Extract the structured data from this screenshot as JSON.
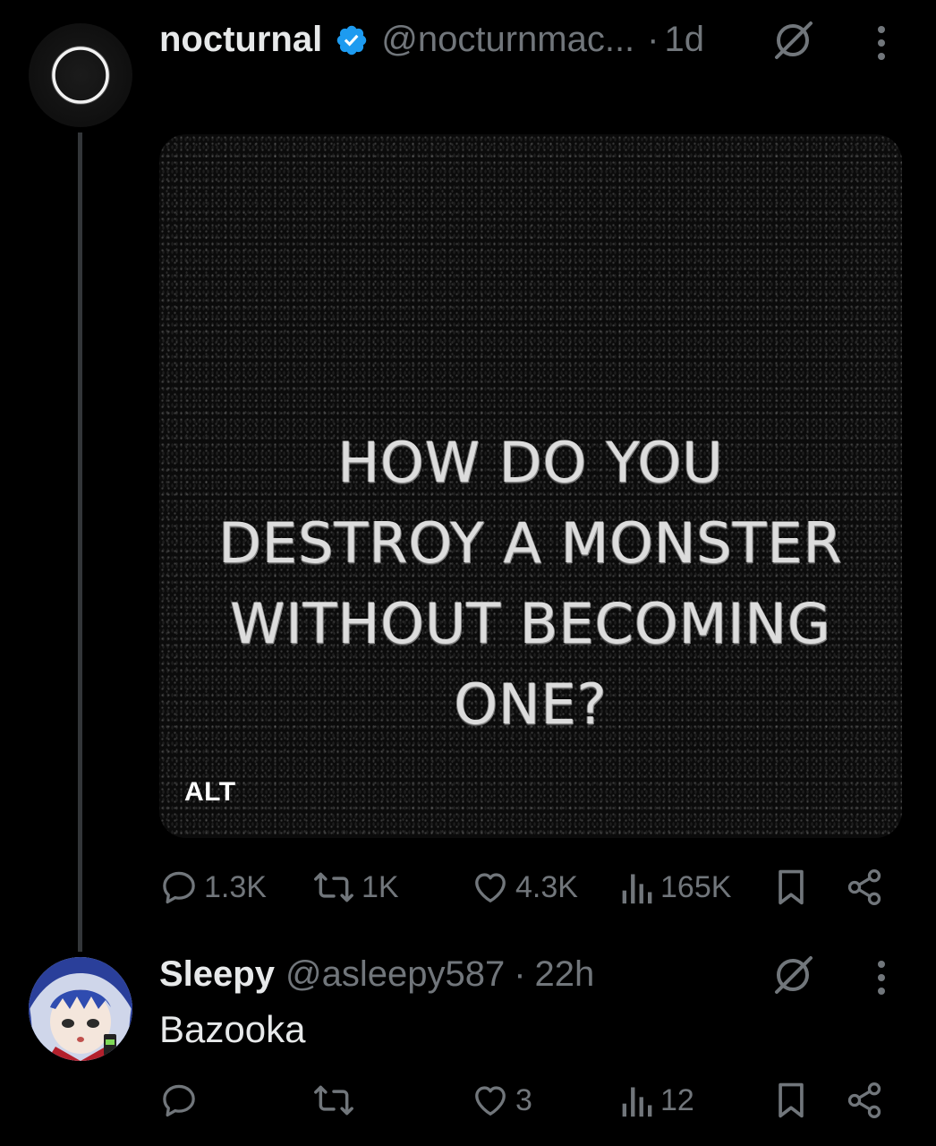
{
  "post": {
    "display_name": "nocturnal",
    "handle": "@nocturnmac...",
    "separator": "·",
    "time": "1d",
    "verified": true,
    "media": {
      "lines": [
        "HOW DO YOU",
        "DESTROY A MONSTER",
        "WITHOUT BECOMING",
        "ONE?"
      ],
      "alt_badge": "ALT"
    },
    "actions": {
      "replies": "1.3K",
      "reposts": "1K",
      "likes": "4.3K",
      "views": "165K"
    }
  },
  "reply": {
    "display_name": "Sleepy",
    "handle": "@asleepy587",
    "separator": "·",
    "time": "22h",
    "text": "Bazooka",
    "actions": {
      "replies": "",
      "reposts": "",
      "likes": "3",
      "views": "12"
    }
  },
  "colors": {
    "background": "#000000",
    "text_primary": "#e7e9ea",
    "text_secondary": "#71767b",
    "verified_blue": "#1d9bf0",
    "thread_line": "#333639"
  },
  "icons": [
    "grok-icon",
    "more-icon",
    "reply-icon",
    "repost-icon",
    "like-icon",
    "views-icon",
    "bookmark-icon",
    "share-icon",
    "verified-badge-icon"
  ]
}
